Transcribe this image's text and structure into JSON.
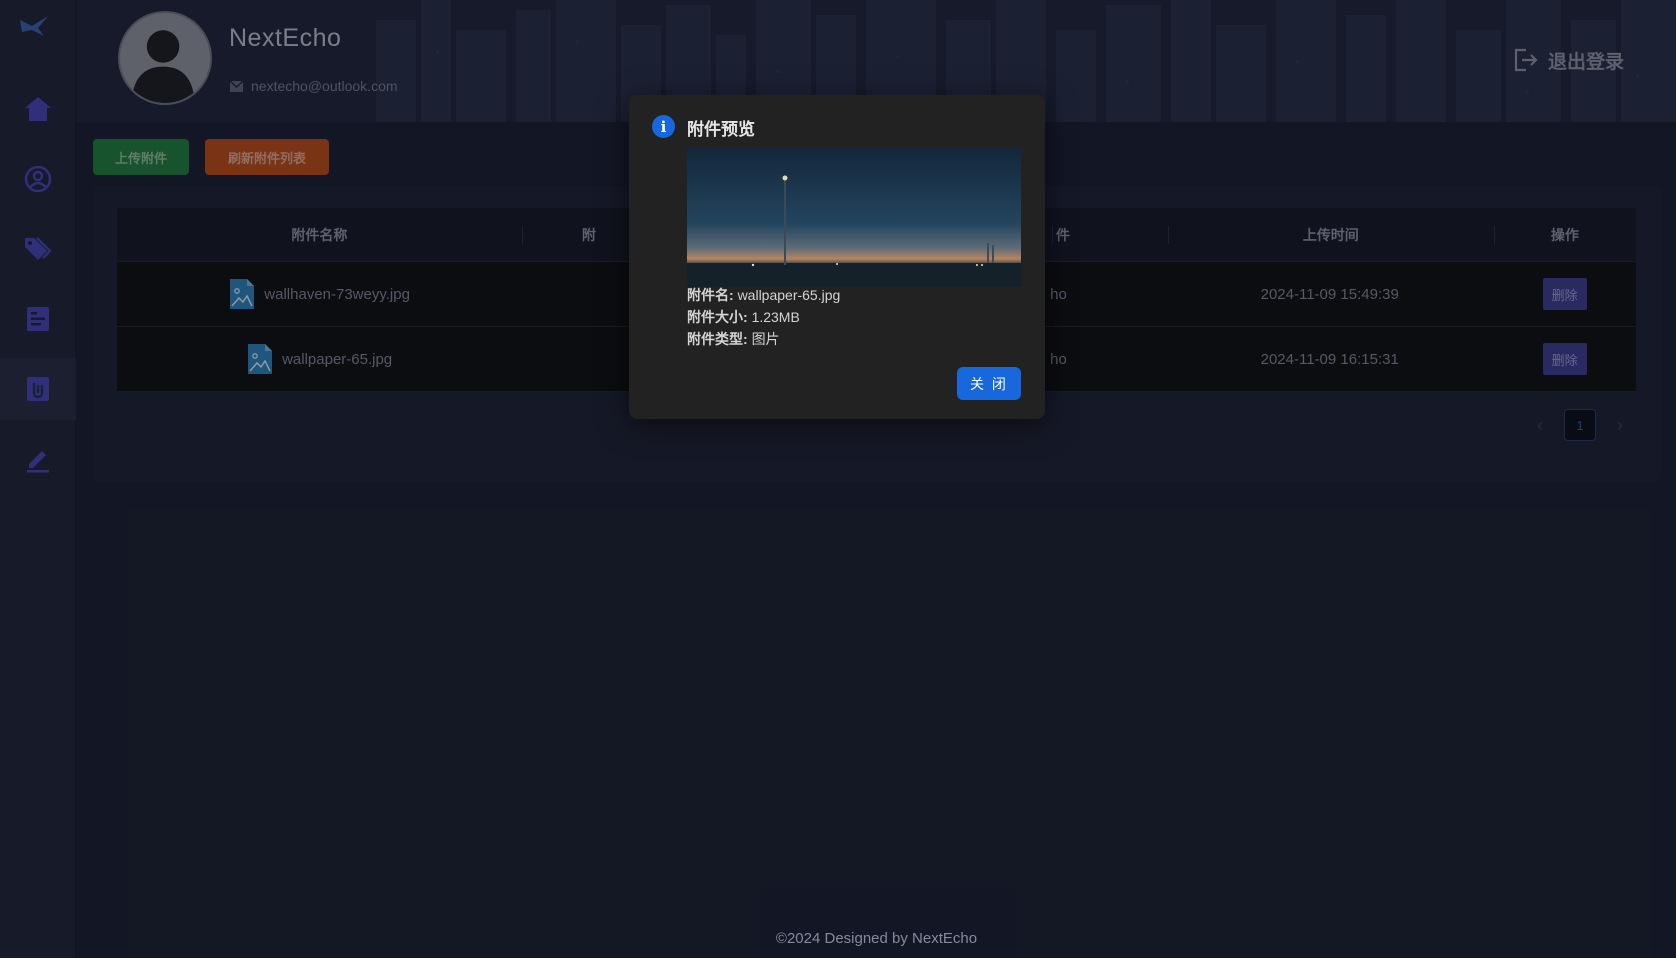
{
  "user": {
    "name": "NextEcho",
    "email": "nextecho@outlook.com"
  },
  "header": {
    "logout_label": "退出登录"
  },
  "sidebar": {
    "items": [
      {
        "name": "home-icon",
        "active": false
      },
      {
        "name": "user-circle-icon",
        "active": false
      },
      {
        "name": "tags-icon",
        "active": false
      },
      {
        "name": "article-icon",
        "active": false
      },
      {
        "name": "attachment-icon",
        "active": true
      },
      {
        "name": "edit-icon",
        "active": false
      }
    ]
  },
  "toolbar": {
    "upload_label": "上传附件",
    "refresh_label": "刷新附件列表"
  },
  "table": {
    "headers": [
      "附件名称",
      "附",
      "",
      "",
      "上传时间",
      "操作"
    ],
    "header_partial_4": "件",
    "rows": [
      {
        "name": "wallhaven-73weyy.jpg",
        "owner_partial": "ho",
        "time": "2024-11-09 15:49:39",
        "action": "删除"
      },
      {
        "name": "wallpaper-65.jpg",
        "owner_partial": "ho",
        "time": "2024-11-09 16:15:31",
        "action": "删除"
      }
    ]
  },
  "pagination": {
    "prev": "‹",
    "current": "1",
    "next": "›"
  },
  "modal": {
    "title": "附件预览",
    "file_name_label": "附件名:",
    "file_name": "wallpaper-65.jpg",
    "file_size_label": "附件大小:",
    "file_size": "1.23MB",
    "file_type_label": "附件类型:",
    "file_type": "图片",
    "close_label": "关 闭",
    "info_icon_glyph": "i"
  },
  "footer": {
    "text": "©2024 Designed by NextEcho"
  },
  "colors": {
    "primary": "#1668dc",
    "upload": "#1f7a3b",
    "refresh": "#b9491a",
    "delete": "#3d3b8e",
    "sidebar_icon": "#3f3fae"
  }
}
